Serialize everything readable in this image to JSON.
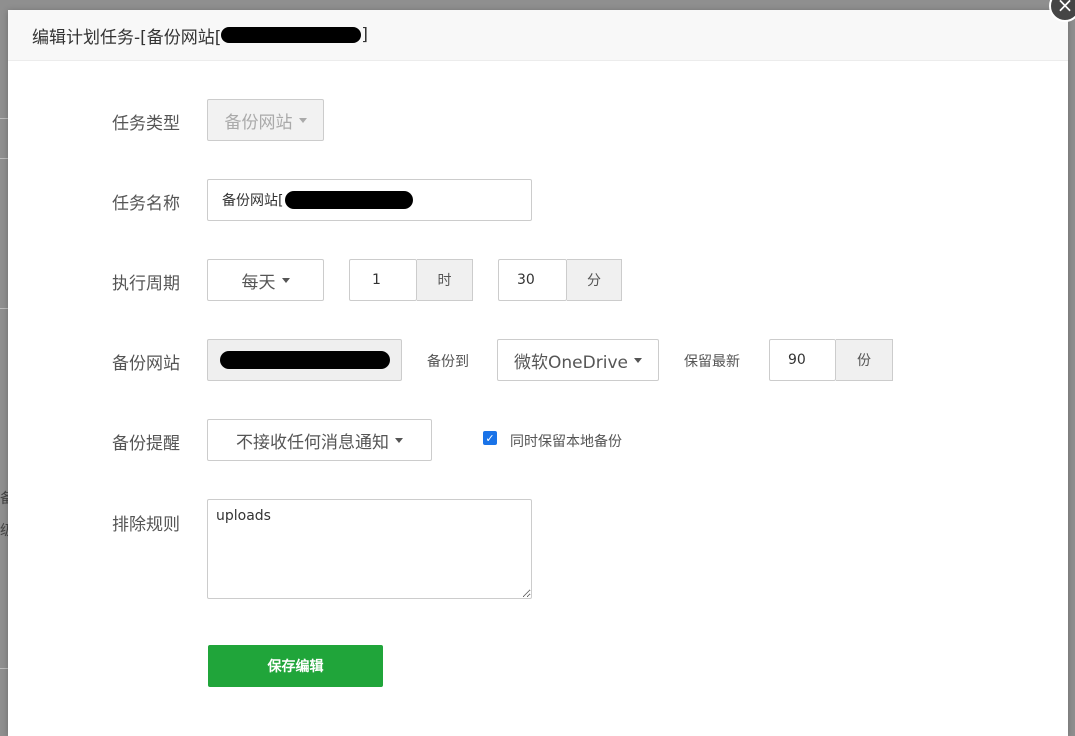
{
  "background": {
    "frag1": "备",
    "frag2": "级"
  },
  "dialog": {
    "title": "编辑计划任务-[备份网站[",
    "title_suffix": "]",
    "close_icon": "×"
  },
  "form": {
    "task_type": {
      "label": "任务类型",
      "value": "备份网站"
    },
    "task_name": {
      "label": "任务名称",
      "value": "备份网站["
    },
    "period": {
      "label": "执行周期",
      "frequency": "每天",
      "hour": "1",
      "hour_unit": "时",
      "minute": "30",
      "minute_unit": "分"
    },
    "backup_site": {
      "label": "备份网站",
      "backup_to_label": "备份到",
      "destination": "微软OneDrive",
      "keep_label": "保留最新",
      "keep_count": "90",
      "keep_unit": "份"
    },
    "notify": {
      "label": "备份提醒",
      "value": "不接收任何消息通知",
      "keep_local_label": "同时保留本地备份",
      "keep_local_checked": true
    },
    "exclude": {
      "label": "排除规则",
      "value": "uploads"
    },
    "save_label": "保存编辑"
  },
  "colors": {
    "primary": "#20a53a",
    "checkbox": "#1a73e8"
  }
}
